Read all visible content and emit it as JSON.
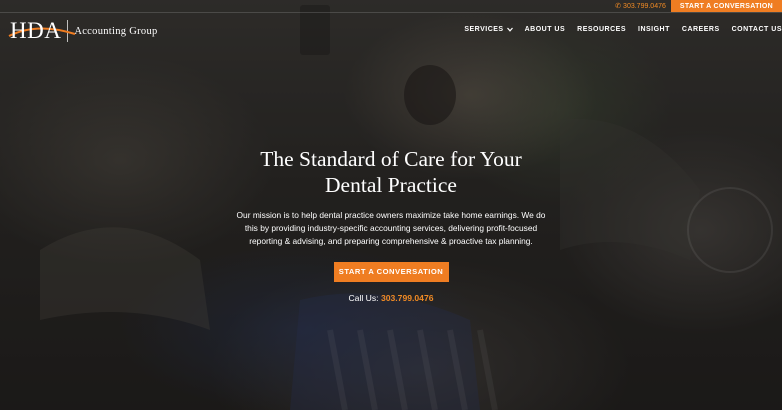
{
  "brand": {
    "logo_mark": "HDA",
    "logo_text": "Accounting Group",
    "accent_color": "#ef7d22"
  },
  "top_bar": {
    "phone": "303.799.0476",
    "phone_icon": "phone-icon",
    "cta_label": "START A CONVERSATION"
  },
  "nav": {
    "items": [
      {
        "label": "SERVICES",
        "has_dropdown": true
      },
      {
        "label": "ABOUT US"
      },
      {
        "label": "RESOURCES"
      },
      {
        "label": "INSIGHT"
      },
      {
        "label": "CAREERS"
      },
      {
        "label": "CONTACT US"
      }
    ]
  },
  "hero": {
    "title": "The Standard of Care for Your Dental Practice",
    "mission": "Our mission is to help dental practice owners maximize take home earnings. We do this by providing industry-specific accounting services, delivering profit-focused reporting & advising, and preparing comprehensive & proactive tax planning.",
    "cta_label": "START A CONVERSATION",
    "call_label": "Call Us:",
    "call_number": "303.799.0476"
  }
}
